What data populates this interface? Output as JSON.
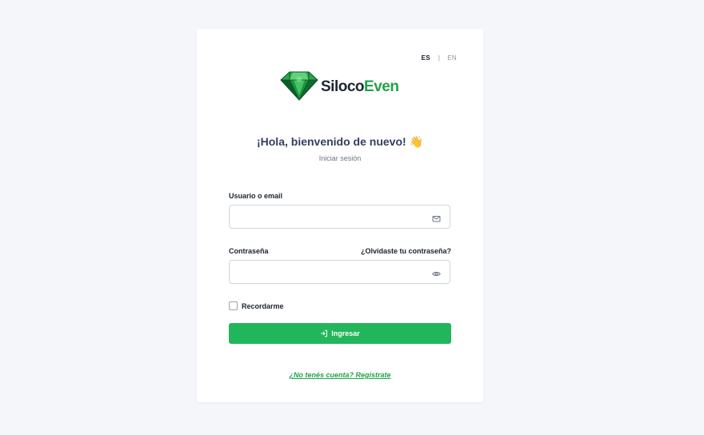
{
  "lang_switch": {
    "es_label": "ES",
    "separator": "|",
    "en_label": "EN",
    "active": "ES"
  },
  "brand": {
    "name_part1": "Siloco",
    "name_part2": "Even",
    "logo_icon": "emerald-diamond-icon",
    "colors": {
      "dark": "#1d2633",
      "green": "#22a24a",
      "gem_dark": "#0f6b2f",
      "gem_light": "#3fbf5f"
    }
  },
  "header": {
    "title": "¡Hola, bienvenido de nuevo! 👋",
    "subtitle": "Iniciar sesión"
  },
  "form": {
    "username": {
      "label": "Usuario o email",
      "value": "",
      "placeholder": "",
      "icon": "envelope-icon"
    },
    "password": {
      "label": "Contraseña",
      "value": "",
      "placeholder": "",
      "icon": "eye-icon"
    },
    "forgot_link": "¿Olvidaste tu contraseña?",
    "remember_label": "Recordarme",
    "remember_checked": false,
    "submit_label": "Ingresar",
    "submit_icon": "login-arrow-icon"
  },
  "footer": {
    "register_link": "¿No tenés cuenta? Registrate"
  },
  "colors": {
    "accent": "#22b65a",
    "page_background": "#f4f6f9",
    "title_color": "#313f5f"
  }
}
